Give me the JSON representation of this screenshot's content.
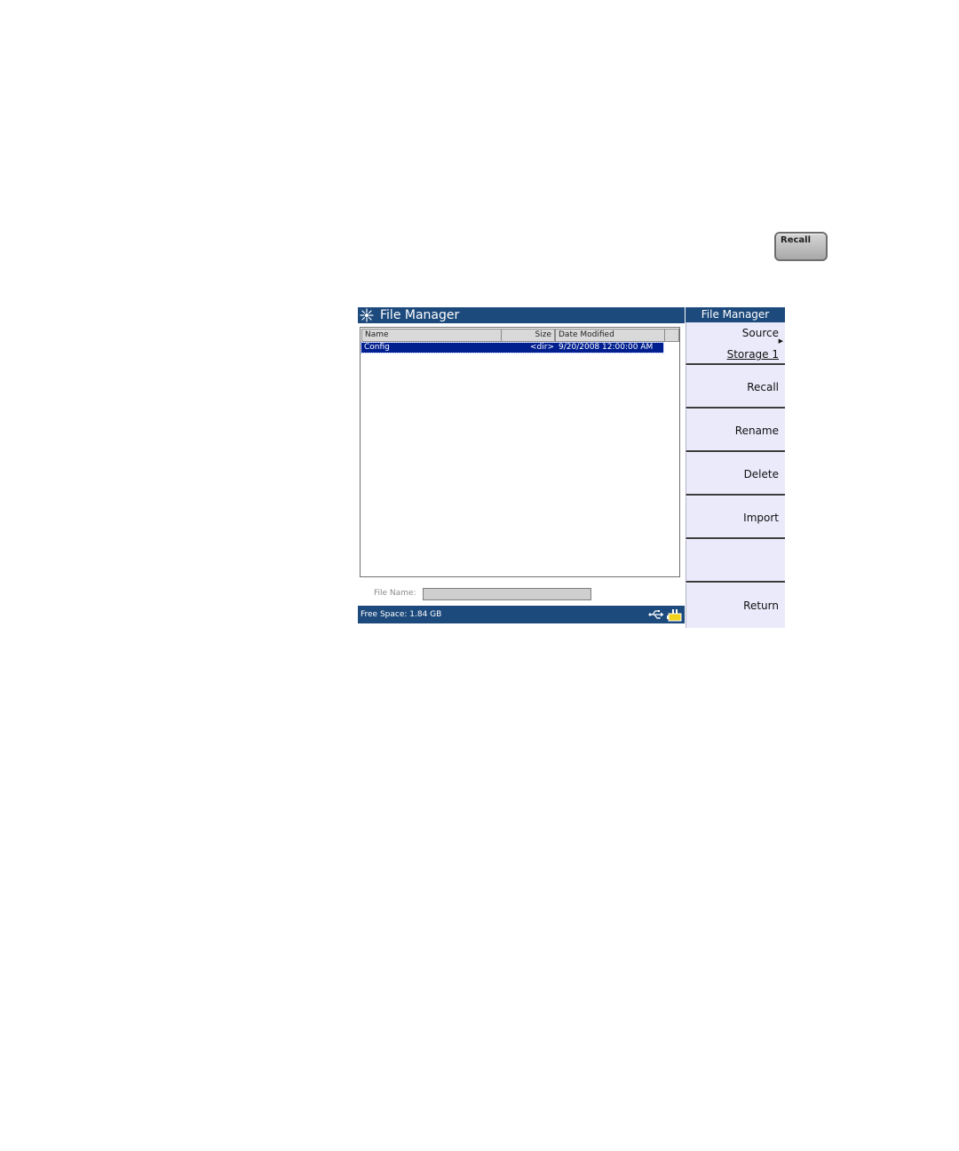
{
  "hardware_key": {
    "label": "Recall"
  },
  "window": {
    "title": "File Manager"
  },
  "file_list": {
    "columns": {
      "name": "Name",
      "size": "Size",
      "date": "Date Modified"
    },
    "rows": [
      {
        "name": "Config",
        "size": "<dir>",
        "date": "9/20/2008 12:00:00 AM"
      }
    ]
  },
  "file_name": {
    "label": "File Name:",
    "value": ""
  },
  "status": {
    "free_space": "Free Space: 1.84 GB"
  },
  "softkeys": {
    "title": "File Manager",
    "source_label": "Source",
    "source_value": "Storage 1",
    "recall": "Recall",
    "rename": "Rename",
    "delete": "Delete",
    "import": "Import",
    "blank": "",
    "return": "Return"
  },
  "colors": {
    "title_bar": "#1d4a7c",
    "selection": "#001f8f",
    "softkey_bg": "#eaeafb"
  },
  "icons": [
    "agilent-logo-icon",
    "usb-icon",
    "power-icon"
  ]
}
